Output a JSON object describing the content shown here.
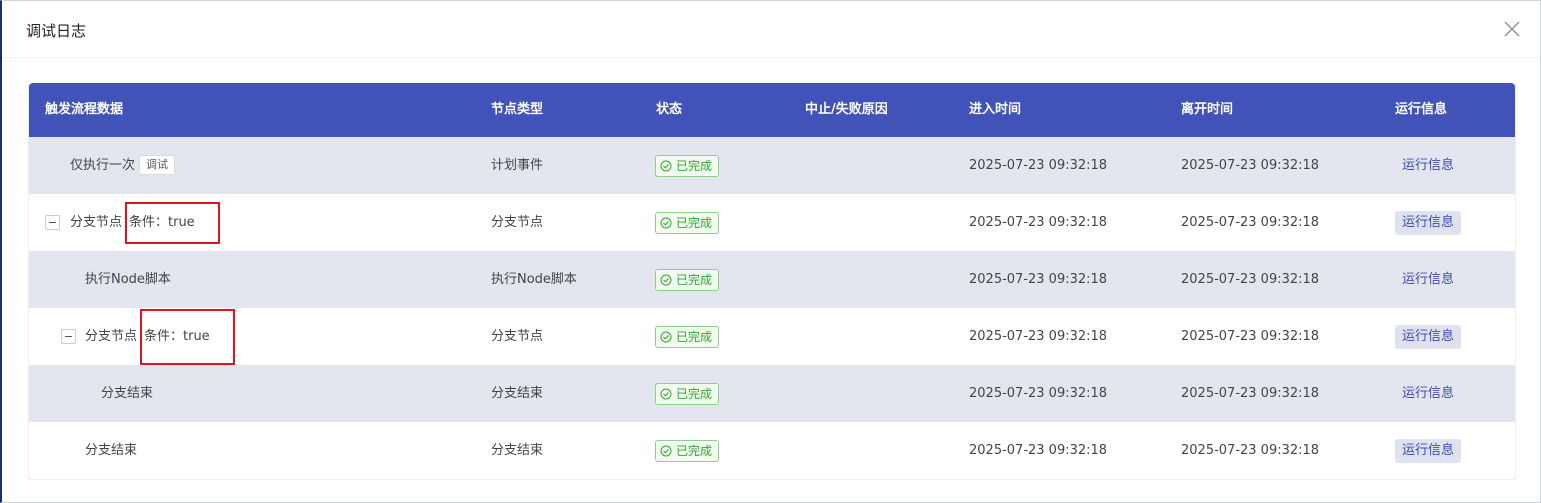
{
  "dialog": {
    "title": "调试日志"
  },
  "table": {
    "headers": {
      "flow_data": "触发流程数据",
      "node_type": "节点类型",
      "status": "状态",
      "reason": "中止/失败原因",
      "enter_time": "进入时间",
      "leave_time": "离开时间",
      "run_info": "运行信息"
    },
    "rows": [
      {
        "name": "仅执行一次",
        "tag": "调试",
        "node_type": "计划事件",
        "status": "已完成",
        "reason": "",
        "enter_time": "2025-07-23 09:32:18",
        "leave_time": "2025-07-23 09:32:18",
        "run_info": "运行信息"
      },
      {
        "name": "分支节点",
        "condition": "条件：true",
        "node_type": "分支节点",
        "status": "已完成",
        "reason": "",
        "enter_time": "2025-07-23 09:32:18",
        "leave_time": "2025-07-23 09:32:18",
        "run_info": "运行信息"
      },
      {
        "name": "执行Node脚本",
        "node_type": "执行Node脚本",
        "status": "已完成",
        "reason": "",
        "enter_time": "2025-07-23 09:32:18",
        "leave_time": "2025-07-23 09:32:18",
        "run_info": "运行信息"
      },
      {
        "name": "分支节点",
        "condition": "条件：true",
        "node_type": "分支节点",
        "status": "已完成",
        "reason": "",
        "enter_time": "2025-07-23 09:32:18",
        "leave_time": "2025-07-23 09:32:18",
        "run_info": "运行信息"
      },
      {
        "name": "分支结束",
        "node_type": "分支结束",
        "status": "已完成",
        "reason": "",
        "enter_time": "2025-07-23 09:32:18",
        "leave_time": "2025-07-23 09:32:18",
        "run_info": "运行信息"
      },
      {
        "name": "分支结束",
        "node_type": "分支结束",
        "status": "已完成",
        "reason": "",
        "enter_time": "2025-07-23 09:32:18",
        "leave_time": "2025-07-23 09:32:18",
        "run_info": "运行信息"
      }
    ]
  },
  "colors": {
    "header_bg": "#4152b8",
    "alt_row_bg": "#e3e6ef",
    "status_green": "#33a532",
    "highlight_red": "#e0141e",
    "link_blue": "#3c4cb0"
  },
  "icons": {
    "close": "close-icon",
    "status": "check-circle-icon",
    "expand": "minus-square-icon"
  }
}
